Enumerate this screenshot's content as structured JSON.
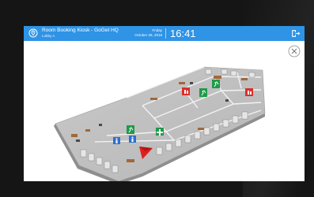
{
  "header": {
    "title": "Room Booking Kiosk - GoGet HQ",
    "subtitle": "Lobby A",
    "day": "Friday",
    "date": "October 26, 2018",
    "time": "16:41"
  },
  "colors": {
    "header_bg": "#2f93e6",
    "emergency_sign": "#d9312b",
    "exit_sign": "#1f9a4a",
    "first_aid": "#1f9a4a",
    "restroom_sign": "#2d6fd2",
    "you_are_here": "#e01f1f"
  },
  "icons": {
    "location": "location-pin-icon",
    "logout": "logout-icon",
    "close": "close-icon"
  }
}
